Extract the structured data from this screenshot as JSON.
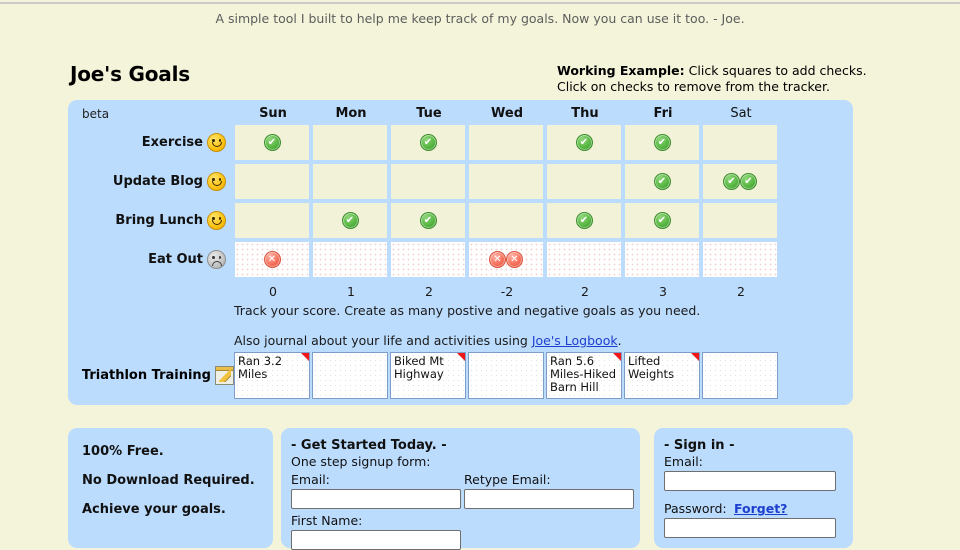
{
  "tagline": "A simple tool I built to help me keep track of my goals. Now you can use it too. - Joe.",
  "header": {
    "title": "Joe's Goals",
    "working_example_label": "Working Example:",
    "working_example_line1": " Click squares to add checks.",
    "working_example_line2": "Click on checks to remove from the tracker."
  },
  "tracker": {
    "beta_label": "beta",
    "days": [
      {
        "label": "Sun",
        "active": true
      },
      {
        "label": "Mon",
        "active": true
      },
      {
        "label": "Tue",
        "active": true
      },
      {
        "label": "Wed",
        "active": true
      },
      {
        "label": "Thu",
        "active": true
      },
      {
        "label": "Fri",
        "active": true
      },
      {
        "label": "Sat",
        "active": false
      }
    ],
    "goals": [
      {
        "name": "Exercise",
        "type": "positive",
        "icon": "smiley-happy-icon",
        "marks": [
          1,
          0,
          1,
          0,
          1,
          1,
          0
        ]
      },
      {
        "name": "Update Blog",
        "type": "positive",
        "icon": "smiley-happy-icon",
        "marks": [
          0,
          0,
          0,
          0,
          0,
          1,
          2
        ]
      },
      {
        "name": "Bring Lunch",
        "type": "positive",
        "icon": "smiley-happy-icon",
        "marks": [
          0,
          1,
          1,
          0,
          1,
          1,
          0
        ]
      },
      {
        "name": "Eat Out",
        "type": "negative",
        "icon": "smiley-sad-icon",
        "marks": [
          1,
          0,
          0,
          2,
          0,
          0,
          0
        ]
      }
    ],
    "scores": [
      "0",
      "1",
      "2",
      "-2",
      "2",
      "3",
      "2"
    ],
    "info_line1": "Track your score. Create as many postive and negative goals as you need.",
    "info_line2_pre": "Also journal about your life and activities using ",
    "info_line2_link": "Joe's Logbook",
    "info_line2_post": ".",
    "notes_label": "Triathlon Training",
    "notes_icon": "edit-notepad-icon",
    "notes": [
      {
        "text": "Ran 3.2 Miles",
        "flagged": true
      },
      {
        "text": "",
        "flagged": false
      },
      {
        "text": "Biked Mt Highway",
        "flagged": true
      },
      {
        "text": "",
        "flagged": false
      },
      {
        "text": "Ran 5.6 Miles-Hiked Barn Hill",
        "flagged": true
      },
      {
        "text": "Lifted Weights",
        "flagged": true
      },
      {
        "text": "",
        "flagged": false
      }
    ]
  },
  "features": {
    "line1": "100% Free.",
    "line2": "No Download Required.",
    "line3": "Achieve your goals."
  },
  "signup": {
    "title": "- Get Started Today. -",
    "subtitle": "One step signup form:",
    "email_label": "Email:",
    "email_value": "",
    "retype_label": "Retype Email:",
    "retype_value": "",
    "firstname_label": "First Name:"
  },
  "signin": {
    "title": "- Sign in -",
    "email_label": "Email:",
    "email_value": "",
    "password_label": "Password:",
    "forget_link": "Forget?"
  },
  "colors": {
    "page_bg": "#f4f4da",
    "panel_bg": "#bcdcfd",
    "cell_bg": "#f2f2d9",
    "check_green": "#58b842",
    "x_red": "#f6715c",
    "link_blue": "#1d3fcf",
    "flag_red": "#f01818"
  }
}
